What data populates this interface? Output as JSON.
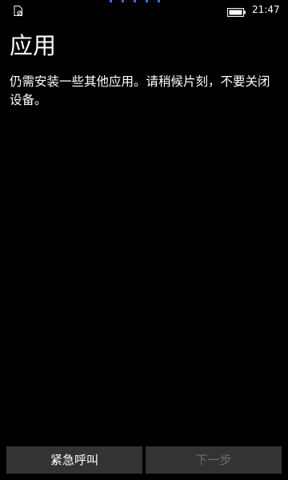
{
  "status_bar": {
    "time": "21:47",
    "sim_icon": "sim-card-icon",
    "battery_icon": "battery-icon",
    "progress_indicator": "progress-dots"
  },
  "page": {
    "title": "应用",
    "message": "仍需安装一些其他应用。请稍候片刻，不要关闭设备。"
  },
  "buttons": {
    "emergency_label": "紧急呼叫",
    "next_label": "下一步",
    "next_enabled": false
  },
  "colors": {
    "background": "#000000",
    "text": "#ffffff",
    "button_bg": "#333333",
    "disabled_text": "#6e6e6e",
    "accent": "#3a6fff"
  }
}
